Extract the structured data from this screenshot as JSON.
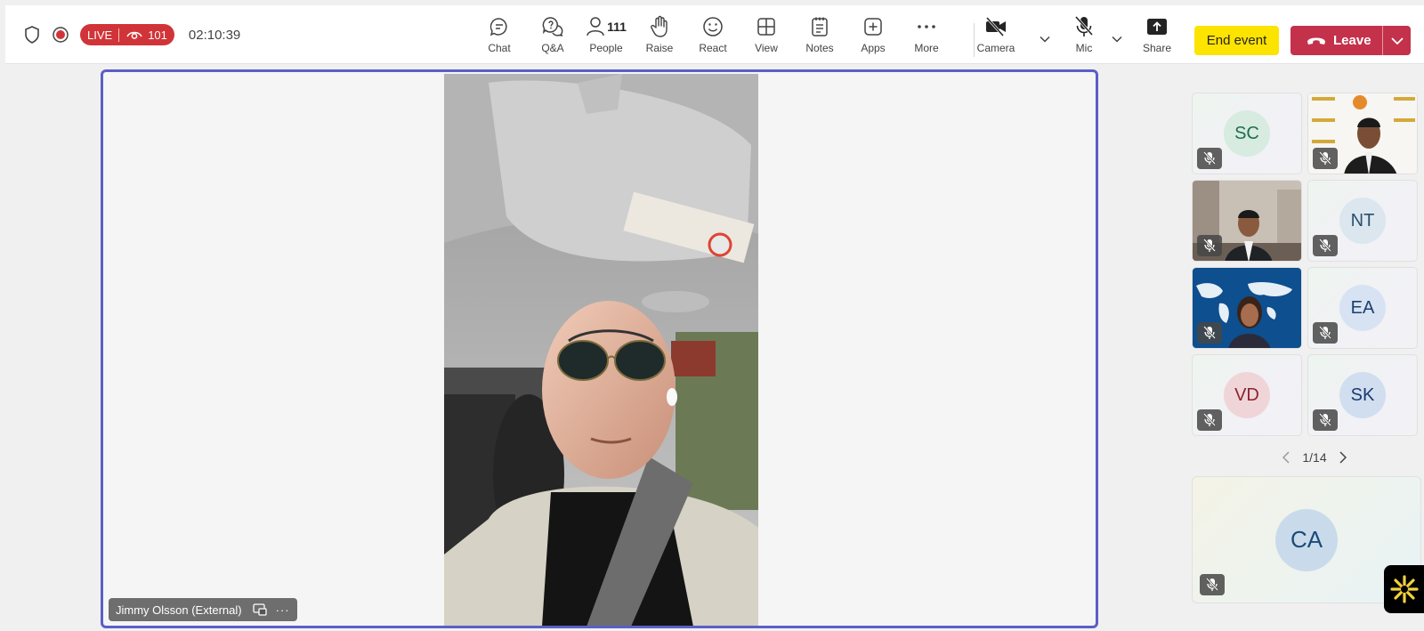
{
  "header": {
    "live_label": "LIVE",
    "viewer_count": "101",
    "timer": "02:10:39"
  },
  "toolbar": {
    "chat": "Chat",
    "qa": "Q&A",
    "people": "People",
    "people_count": "111",
    "raise": "Raise",
    "react": "React",
    "view": "View",
    "notes": "Notes",
    "apps": "Apps",
    "more": "More",
    "camera": "Camera",
    "mic": "Mic",
    "share": "Share",
    "end_event": "End event",
    "leave": "Leave"
  },
  "stage": {
    "presenter_name": "Jimmy Olsson (External)"
  },
  "gallery": {
    "tiles": [
      {
        "initials": "SC",
        "bg": "#d7ebe0",
        "fg": "#1f6e4a"
      },
      {
        "initials": "",
        "video": true
      },
      {
        "initials": "",
        "video": true
      },
      {
        "initials": "NT",
        "bg": "#dbe6ef",
        "fg": "#2b4f6e"
      },
      {
        "initials": "",
        "video": true
      },
      {
        "initials": "EA",
        "bg": "#d7e3f2",
        "fg": "#1b3f6e"
      },
      {
        "initials": "VD",
        "bg": "#f0d5d8",
        "fg": "#8a2431"
      },
      {
        "initials": "SK",
        "bg": "#d0def0",
        "fg": "#1b3a6e"
      }
    ],
    "page_indicator": "1/14"
  },
  "spotlight_tile": {
    "initials": "CA"
  },
  "colors": {
    "accent": "#5b5fc7",
    "live_red": "#d13438",
    "leave_red": "#c4314b",
    "end_yellow": "#fde300"
  }
}
